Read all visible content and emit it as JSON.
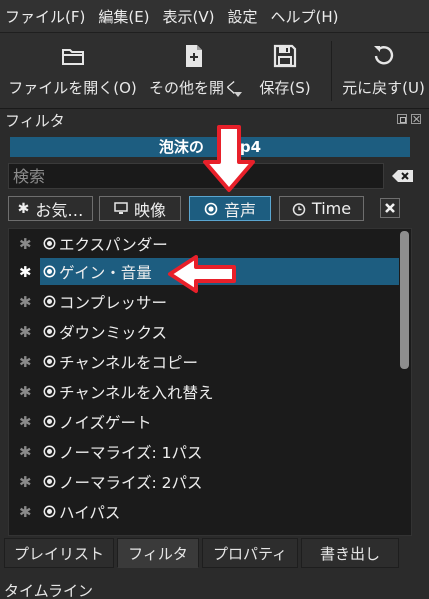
{
  "menu": [
    "ファイル(F)",
    "編集(E)",
    "表示(V)",
    "設定",
    "ヘルプ(H)"
  ],
  "toolbar": {
    "open_file": "ファイルを開く(O)",
    "open_other": "その他を開く",
    "save": "保存(S)",
    "undo": "元に戻す(U)"
  },
  "panel": {
    "title": "フィルタ"
  },
  "clip": {
    "title": "泡沫の",
    "suffix": "p4"
  },
  "search": {
    "placeholder": "検索",
    "value": ""
  },
  "filter_tabs": {
    "favorites": "お気…",
    "video": "映像",
    "audio": "音声",
    "time": "Time"
  },
  "filters": [
    {
      "label": "エクスパンダー",
      "favorite": false,
      "selected": false
    },
    {
      "label": "ゲイン・音量",
      "favorite": true,
      "selected": true
    },
    {
      "label": "コンプレッサー",
      "favorite": false,
      "selected": false
    },
    {
      "label": "ダウンミックス",
      "favorite": false,
      "selected": false
    },
    {
      "label": "チャンネルをコピー",
      "favorite": false,
      "selected": false
    },
    {
      "label": "チャンネルを入れ替え",
      "favorite": false,
      "selected": false
    },
    {
      "label": "ノイズゲート",
      "favorite": false,
      "selected": false
    },
    {
      "label": "ノーマライズ: 1パス",
      "favorite": false,
      "selected": false
    },
    {
      "label": "ノーマライズ: 2パス",
      "favorite": false,
      "selected": false
    },
    {
      "label": "ハイパス",
      "favorite": false,
      "selected": false
    }
  ],
  "bottom_tabs": [
    "プレイリスト",
    "フィルタ",
    "プロパティ",
    "書き出し"
  ],
  "timeline": {
    "title": "タイムライン"
  },
  "colors": {
    "accent": "#1d5d80",
    "annotation": "#e8202a",
    "background": "#2b2b2b",
    "list_bg": "#1b1b1b"
  }
}
